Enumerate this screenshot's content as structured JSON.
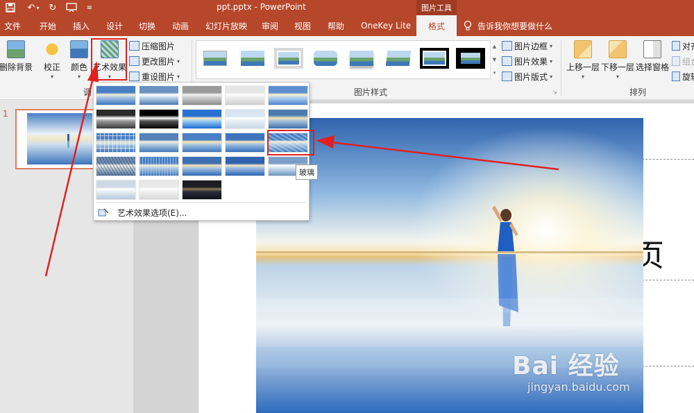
{
  "window": {
    "doc_title": "ppt.pptx  -  PowerPoint",
    "context_tab_title": "图片工具"
  },
  "ribbon_tabs": [
    "文件",
    "开始",
    "插入",
    "设计",
    "切换",
    "动画",
    "幻灯片放映",
    "审阅",
    "视图",
    "帮助",
    "OneKey Lite",
    "格式"
  ],
  "active_tab": "格式",
  "tell_me": "告诉我你想要做什么",
  "adjust_group": {
    "remove_bg": "删除背景",
    "corrections": "校正",
    "color": "颜色",
    "artistic_effects": "艺术效果",
    "compress": "压缩图片",
    "change_picture": "更改图片",
    "reset_picture": "重设图片",
    "group_label_partial": "调"
  },
  "picture_styles": {
    "group_label": "图片样式",
    "border": "图片边框",
    "effects": "图片效果",
    "layout": "图片版式"
  },
  "arrange": {
    "group_label": "排列",
    "bring_forward": "上移一层",
    "send_backward": "下移一层",
    "selection_pane": "选择窗格",
    "align": "对齐",
    "group": "组合",
    "rotate": "旋转"
  },
  "slides_pane": {
    "slide_number": "1"
  },
  "art_menu": {
    "options_label": "艺术效果选项(E)...",
    "hover_tooltip": "玻璃"
  },
  "slide": {
    "title_glyph": "页"
  },
  "watermark": {
    "brand": "Bai 经验",
    "site": "jingyan.baidu.com"
  },
  "colors": {
    "ppt_accent": "#b7472a",
    "annotation_red": "#e02020"
  }
}
